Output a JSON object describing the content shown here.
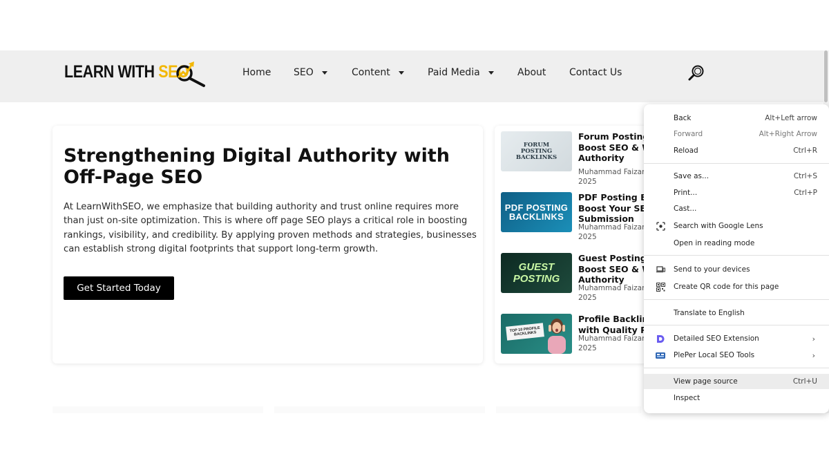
{
  "logo": {
    "learn": "LEARN WITH ",
    "seo": "SEO"
  },
  "nav": {
    "home": "Home",
    "seo": "SEO",
    "content": "Content",
    "paid_media": "Paid Media",
    "about": "About",
    "contact": "Contact Us"
  },
  "hero": {
    "title": "Strengthening Digital Authority with Off-Page SEO",
    "body": "At LearnWithSEO, we emphasize that building authority and trust online requires more than just on-site optimization. This is where off page SEO plays a critical role in boosting rankings, visibility, and credibility. By applying proven methods and strategies, businesses can establish strong digital footprints that support long-term growth.",
    "cta": "Get Started Today"
  },
  "posts": [
    {
      "thumb_text": "FORUM POSTING BACKLINKS",
      "title_lines": [
        "Forum Posting",
        "Boost SEO & W",
        "Authority"
      ],
      "author": "Muhammad Faizan",
      "date": "2025"
    },
    {
      "thumb_text": "PDF POSTING BACKLINKS",
      "title_lines": [
        "PDF Posting Ba",
        "Boost Your SEO",
        "Submission"
      ],
      "author": "Muhammad Faizan",
      "date": "2025"
    },
    {
      "thumb_text": "GUEST POSTING",
      "title_lines": [
        "Guest Posting",
        "Boost SEO & W",
        "Authority"
      ],
      "author": "Muhammad Faizan",
      "date": "2025"
    },
    {
      "thumb_text": "TOP 10 PROFILE BACKLINKS",
      "title_lines": [
        "Profile Backlink",
        "with Quality Pr"
      ],
      "author": "Muhammad Faizan",
      "date": "2025"
    }
  ],
  "menu": {
    "back": {
      "label": "Back",
      "shortcut": "Alt+Left arrow"
    },
    "forward": {
      "label": "Forward",
      "shortcut": "Alt+Right Arrow"
    },
    "reload": {
      "label": "Reload",
      "shortcut": "Ctrl+R"
    },
    "save_as": {
      "label": "Save as...",
      "shortcut": "Ctrl+S"
    },
    "print": {
      "label": "Print...",
      "shortcut": "Ctrl+P"
    },
    "cast": {
      "label": "Cast..."
    },
    "search_lens": {
      "label": "Search with Google Lens"
    },
    "reading_mode": {
      "label": "Open in reading mode"
    },
    "send_devices": {
      "label": "Send to your devices"
    },
    "qr_code": {
      "label": "Create QR code for this page"
    },
    "translate": {
      "label": "Translate to English"
    },
    "detailed_seo": {
      "label": "Detailed SEO Extension"
    },
    "pleper": {
      "label": "PlePer Local SEO Tools"
    },
    "view_source": {
      "label": "View page source",
      "shortcut": "Ctrl+U"
    },
    "inspect": {
      "label": "Inspect"
    }
  },
  "colors": {
    "brand_yellow": "#f2b705",
    "header_bg": "#efefef",
    "menu_highlight": "#ececec",
    "extension_purple": "#6a5cf0"
  },
  "icons": [
    "search-icon",
    "logo-lens-icon",
    "google-lens-icon",
    "send-devices-icon",
    "qr-code-icon",
    "detailed-seo-icon",
    "pleper-icon",
    "chevron-right-icon"
  ]
}
